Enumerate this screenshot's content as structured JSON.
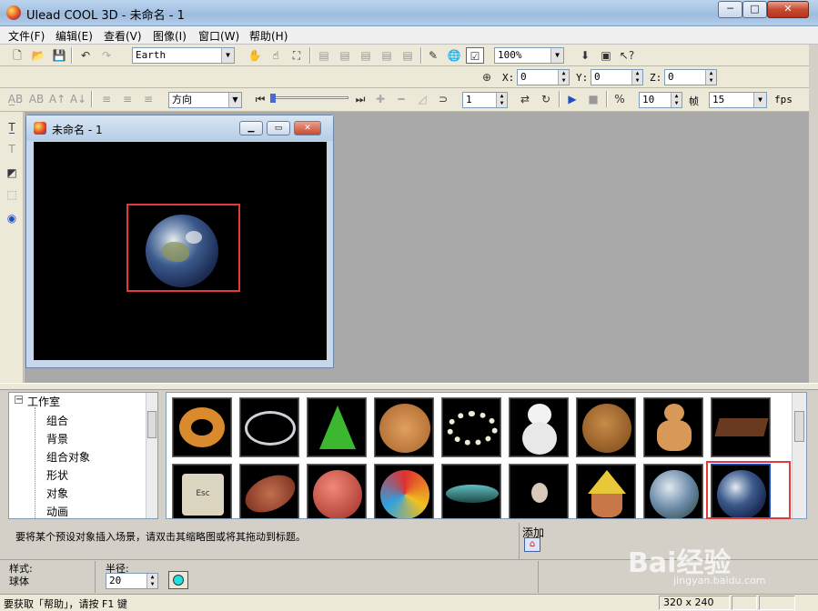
{
  "window": {
    "title": "Ulead COOL 3D - 未命名 - 1",
    "min": "─",
    "max": "□",
    "close": "✕"
  },
  "menu": [
    "文件(F)",
    "编辑(E)",
    "查看(V)",
    "图像(I)",
    "窗口(W)",
    "帮助(H)"
  ],
  "toolbar1": {
    "object_combo": "Earth",
    "zoom_combo": "100%"
  },
  "toolbar2": {
    "x_label": "X:",
    "x_value": "0",
    "y_label": "Y:",
    "y_value": "0",
    "z_label": "Z:",
    "z_value": "0"
  },
  "toolbar3": {
    "direction_combo": "方向",
    "frame_value": "1",
    "frames_total": "10",
    "frame_unit": "帧",
    "fps_value": "15",
    "fps_unit": "fps"
  },
  "document": {
    "title": "未命名 - 1"
  },
  "tree": {
    "root": "工作室",
    "items": [
      "组合",
      "背景",
      "组合对象",
      "形状",
      "对象",
      "动画"
    ]
  },
  "gallery": {
    "items": [
      "donut",
      "ring",
      "cone",
      "cookie",
      "pearl-necklace",
      "snowman",
      "bear-head",
      "gingerbread-man",
      "chocolate-bar",
      "esc-key",
      "football",
      "basketball",
      "beach-ball",
      "spinning-top",
      "light-bulb",
      "face-pyramid",
      "glass-sphere",
      "earth"
    ],
    "selected_index": 17
  },
  "hint": "要将某个预设对象插入场景，请双击其缩略图或将其拖动到标题。",
  "add_label": "添加",
  "props": {
    "style_label": "样式:",
    "style_value": "球体",
    "radius_label": "半径:",
    "radius_value": "20"
  },
  "status": {
    "help": "要获取「帮助」，请按 F1 键",
    "size": "320 x 240"
  },
  "watermark": {
    "brand": "Bai经验",
    "url": "jingyan.baidu.com"
  },
  "colors": {
    "selection_box": "#e03a3a",
    "workspace": "#a9a9a9",
    "canvas": "#000000"
  }
}
